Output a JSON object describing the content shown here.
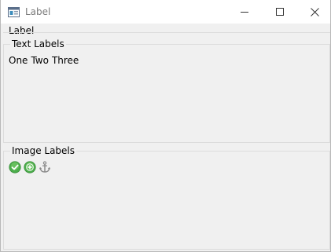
{
  "window": {
    "title": "Label",
    "icon": "app-window-icon",
    "controls": {
      "minimize": "minimize-icon",
      "maximize": "maximize-icon",
      "close": "close-icon"
    }
  },
  "main": {
    "label": "Label",
    "text_group": {
      "title": "Text Labels",
      "labels": [
        "One",
        "Two",
        "Three"
      ]
    },
    "image_group": {
      "title": "Image Labels",
      "icons": [
        "green-check-icon",
        "green-add-icon",
        "anchor-icon"
      ]
    }
  },
  "colors": {
    "titlebar": "#ffffff",
    "background": "#f0f0f0",
    "group_border": "#dcdcdc",
    "icon_green": "#5cb85c"
  }
}
